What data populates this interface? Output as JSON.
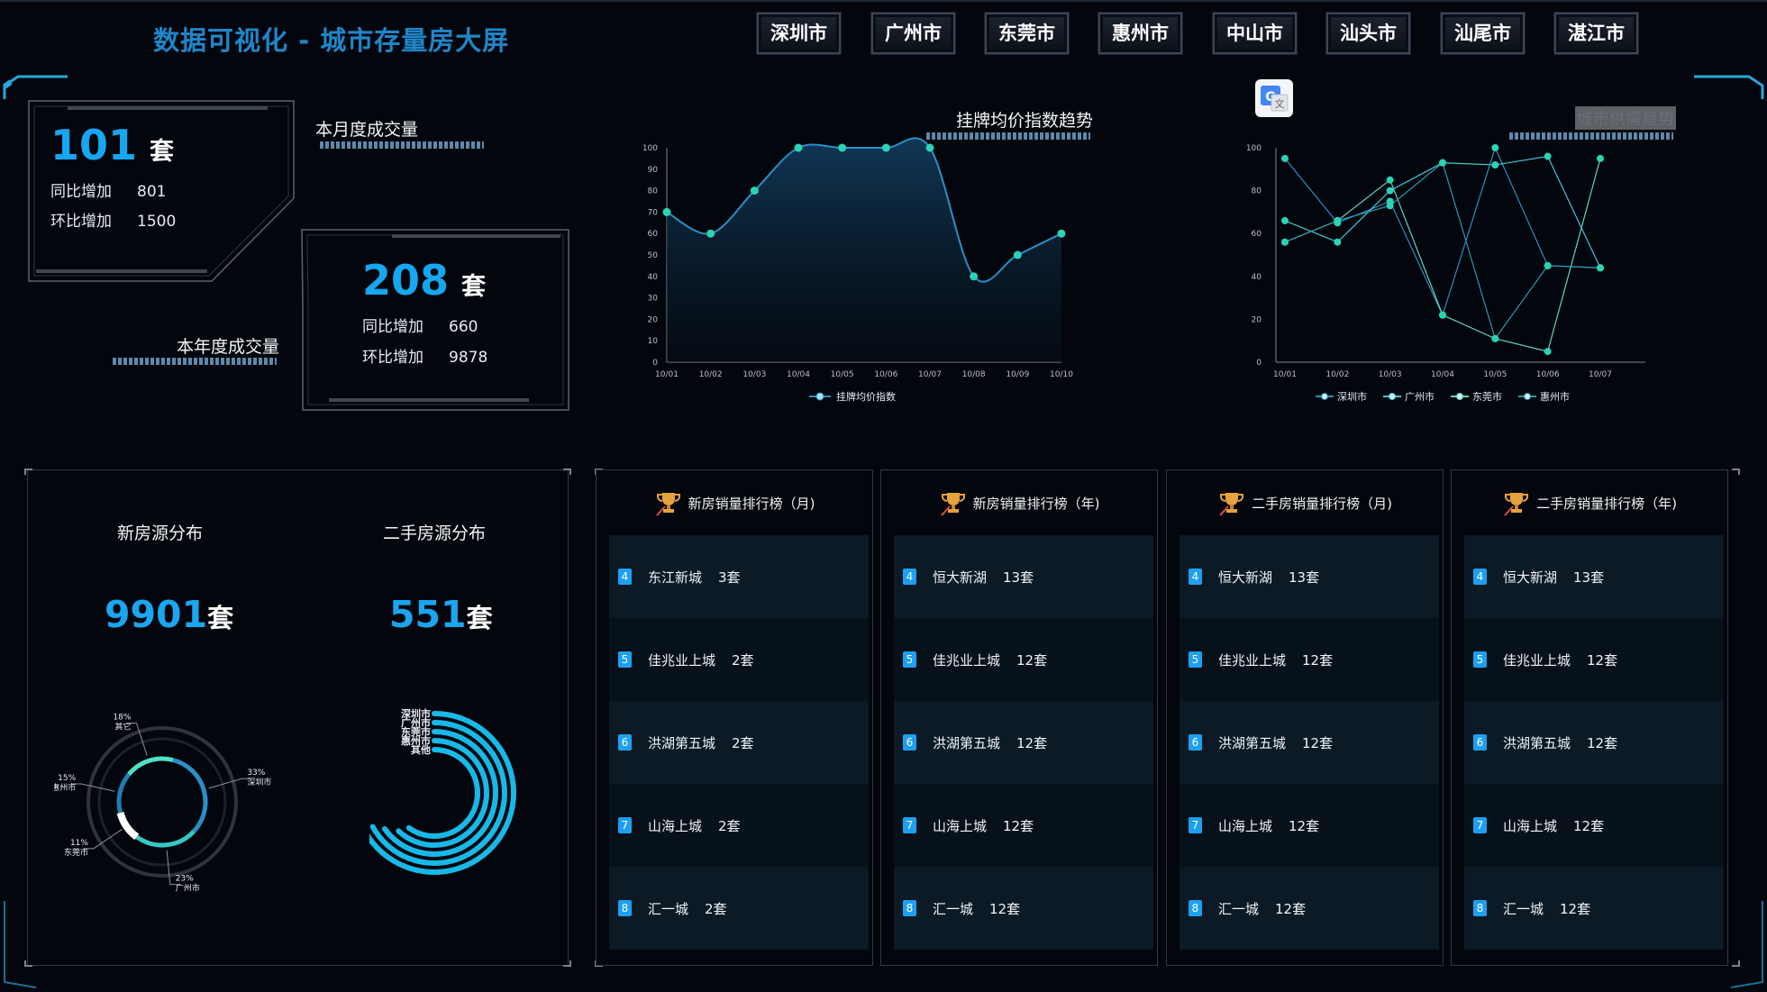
{
  "header": {
    "title": "数据可视化 - 城市存量房大屏"
  },
  "cities": [
    "深圳市",
    "广州市",
    "东莞市",
    "惠州市",
    "中山市",
    "汕头市",
    "汕尾市",
    "湛江市"
  ],
  "monthly": {
    "label": "本月度成交量",
    "value": "101",
    "unit": "套",
    "yoy_label": "同比增加",
    "yoy": "801",
    "mom_label": "环比增加",
    "mom": "1500"
  },
  "yearly": {
    "label": "本年度成交量",
    "value": "208",
    "unit": "套",
    "yoy_label": "同比增加",
    "yoy": "660",
    "mom_label": "环比增加",
    "mom": "9878"
  },
  "chart_data": [
    {
      "type": "area",
      "title": "挂牌均价指数趋势",
      "categories": [
        "10/01",
        "10/02",
        "10/03",
        "10/04",
        "10/05",
        "10/06",
        "10/07",
        "10/08",
        "10/09",
        "10/10"
      ],
      "series": [
        {
          "name": "挂牌均价指数",
          "values": [
            70,
            60,
            80,
            100,
            100,
            100,
            100,
            40,
            50,
            60
          ]
        }
      ],
      "ylim": [
        0,
        100
      ],
      "yticks": [
        "0",
        "10",
        "20",
        "30",
        "40",
        "50",
        "60",
        "70",
        "80",
        "90",
        "100"
      ],
      "legend": "bottom",
      "color": "#2bd3b4"
    },
    {
      "type": "line",
      "title": "城市供需趋势",
      "categories": [
        "10/01",
        "10/02",
        "10/03",
        "10/04",
        "10/05",
        "10/06",
        "10/07"
      ],
      "series": [
        {
          "name": "深圳市",
          "values": [
            95,
            65,
            75,
            22,
            100,
            45,
            44
          ]
        },
        {
          "name": "广州市",
          "values": [
            66,
            56,
            80,
            93,
            92,
            96,
            44
          ]
        },
        {
          "name": "东莞市",
          "values": [
            56,
            66,
            85,
            22,
            11,
            5,
            95
          ]
        },
        {
          "name": "惠州市",
          "values": [
            56,
            66,
            73,
            93,
            11,
            45,
            44
          ]
        }
      ],
      "ylim": [
        0,
        100
      ],
      "yticks": [
        "0",
        "20",
        "40",
        "60",
        "80",
        "100"
      ],
      "legend": "bottom"
    },
    {
      "type": "pie",
      "title": "新房源分布",
      "categories": [
        "深圳市",
        "广州市",
        "东莞市",
        "惠州市",
        "其它"
      ],
      "values": [
        33,
        23,
        11,
        15,
        18
      ],
      "labels": [
        "33%",
        "23%",
        "11%",
        "15%",
        "18%"
      ]
    },
    {
      "type": "bar",
      "title": "二手房源分布",
      "categories": [
        "深圳市",
        "广州市",
        "东莞市",
        "惠州市",
        "其他"
      ],
      "values": [
        0.7,
        0.67,
        0.65,
        0.62,
        0.6
      ]
    }
  ],
  "distribution": {
    "new": {
      "title": "新房源分布",
      "value": "9901",
      "unit": "套"
    },
    "second": {
      "title": "二手房源分布",
      "value": "551",
      "unit": "套"
    }
  },
  "rankings": [
    {
      "title": "新房销量排行榜（月)",
      "items": [
        {
          "rank": "4",
          "name": "东江新城",
          "count": "3套"
        },
        {
          "rank": "5",
          "name": "佳兆业上城",
          "count": "2套"
        },
        {
          "rank": "6",
          "name": "洪湖第五城",
          "count": "2套"
        },
        {
          "rank": "7",
          "name": "山海上城",
          "count": "2套"
        },
        {
          "rank": "8",
          "name": "汇一城",
          "count": "2套"
        }
      ]
    },
    {
      "title": "新房销量排行榜（年)",
      "items": [
        {
          "rank": "4",
          "name": "恒大新湖",
          "count": "13套"
        },
        {
          "rank": "5",
          "name": "佳兆业上城",
          "count": "12套"
        },
        {
          "rank": "6",
          "name": "洪湖第五城",
          "count": "12套"
        },
        {
          "rank": "7",
          "name": "山海上城",
          "count": "12套"
        },
        {
          "rank": "8",
          "name": "汇一城",
          "count": "12套"
        }
      ]
    },
    {
      "title": "二手房销量排行榜（月)",
      "items": [
        {
          "rank": "4",
          "name": "恒大新湖",
          "count": "13套"
        },
        {
          "rank": "5",
          "name": "佳兆业上城",
          "count": "12套"
        },
        {
          "rank": "6",
          "name": "洪湖第五城",
          "count": "12套"
        },
        {
          "rank": "7",
          "name": "山海上城",
          "count": "12套"
        },
        {
          "rank": "8",
          "name": "汇一城",
          "count": "12套"
        }
      ]
    },
    {
      "title": "二手房销量排行榜（年)",
      "items": [
        {
          "rank": "4",
          "name": "恒大新湖",
          "count": "13套"
        },
        {
          "rank": "5",
          "name": "佳兆业上城",
          "count": "12套"
        },
        {
          "rank": "6",
          "name": "洪湖第五城",
          "count": "12套"
        },
        {
          "rank": "7",
          "name": "山海上城",
          "count": "12套"
        },
        {
          "rank": "8",
          "name": "汇一城",
          "count": "12套"
        }
      ]
    }
  ],
  "colors": {
    "accent": "#17a6f0",
    "title": "#1f86c9",
    "line": "#2bd3b4",
    "teal": "#3ed0c0"
  },
  "icons": {
    "translate": "translate-icon",
    "trophy": "trophy-icon"
  }
}
